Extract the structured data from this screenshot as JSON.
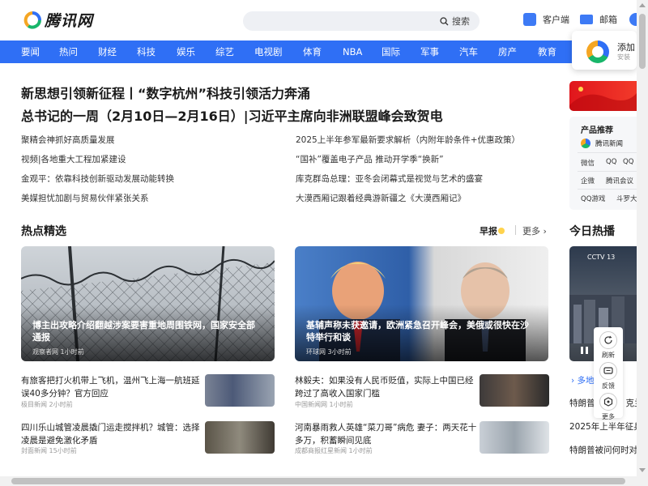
{
  "header": {
    "logo_text": "腾讯网",
    "search_label": "搜索",
    "client_label": "客户端",
    "mail_label": "邮箱"
  },
  "nav": [
    "要闻",
    "热问",
    "财经",
    "科技",
    "娱乐",
    "综艺",
    "电视剧",
    "体育",
    "NBA",
    "国际",
    "军事",
    "汽车",
    "房产",
    "教育"
  ],
  "popup": {
    "title": "添加",
    "subtitle": "安装"
  },
  "headlines": [
    "新思想引领新征程丨“数字杭州”科技引领活力奔涌",
    "总书记的一周（2月10日—2月16日）|习近平主席向非洲联盟峰会致贺电"
  ],
  "links_left": [
    "聚精会神抓好高质量发展",
    "视频|各地重大工程加紧建设",
    "金观平：依靠科技创新驱动发展动能转换",
    "美媒担忧加剧与贸易伙伴紧张关系"
  ],
  "links_right": [
    "2025上半年参军最新要求解析（内附年龄条件+优惠政策）",
    "“国补”覆盖电子产品 推动开学季“换新”",
    "库克群岛总理：亚冬会闭幕式是视觉与艺术的盛宴",
    "大漠西厢记跟着经典游新疆之《大漠西厢记》"
  ],
  "hot": {
    "title": "热点精选",
    "zaobao": "早报",
    "more": "更多",
    "card1": {
      "caption": "博主出攻略介绍翻越涉案要害重地周围铁网，国家安全部通报",
      "meta": "观察者网  1小时前"
    },
    "card2": {
      "caption": "基辅声称未获邀请，欧洲紧急召开峰会，美俄或很快在沙特举行和谈",
      "meta": "环球网  3小时前"
    },
    "items": [
      {
        "title": "有旅客把打火机带上飞机，温州飞上海一航班延误40多分钟？官方回应",
        "meta": "极目新闻  2小时前"
      },
      {
        "title": "四川乐山城管凌晨撬门运走搅拌机？城管：选择凌晨是避免激化矛盾",
        "meta": "封面新闻  15小时前"
      },
      {
        "title": "林毅夫：如果没有人民币贬值，实际上中国已经跨过了高收入国家门槛",
        "meta": "中国新闻网  1小时前"
      },
      {
        "title": "河南暴雨救人英雄“菜刀哥”病危 妻子：两天花十多万，积蓄瞬间见底",
        "meta": "成都商报红星新闻  1小时前"
      }
    ]
  },
  "products": {
    "title": "产品推荐",
    "app": "腾讯新闻",
    "cells": [
      "微信",
      "QQ",
      "QQ",
      "企微",
      "腾讯会议",
      "QQ游戏",
      "斗罗大"
    ]
  },
  "today": {
    "title": "今日热播",
    "more": "多地",
    "items": [
      "特朗普",
      "2025年上半年征兵",
      "特朗普被问何时对"
    ],
    "item_tails": [
      "克兰",
      "",
      ""
    ]
  },
  "float_tools": [
    "刷新",
    "反馈",
    "更多"
  ]
}
